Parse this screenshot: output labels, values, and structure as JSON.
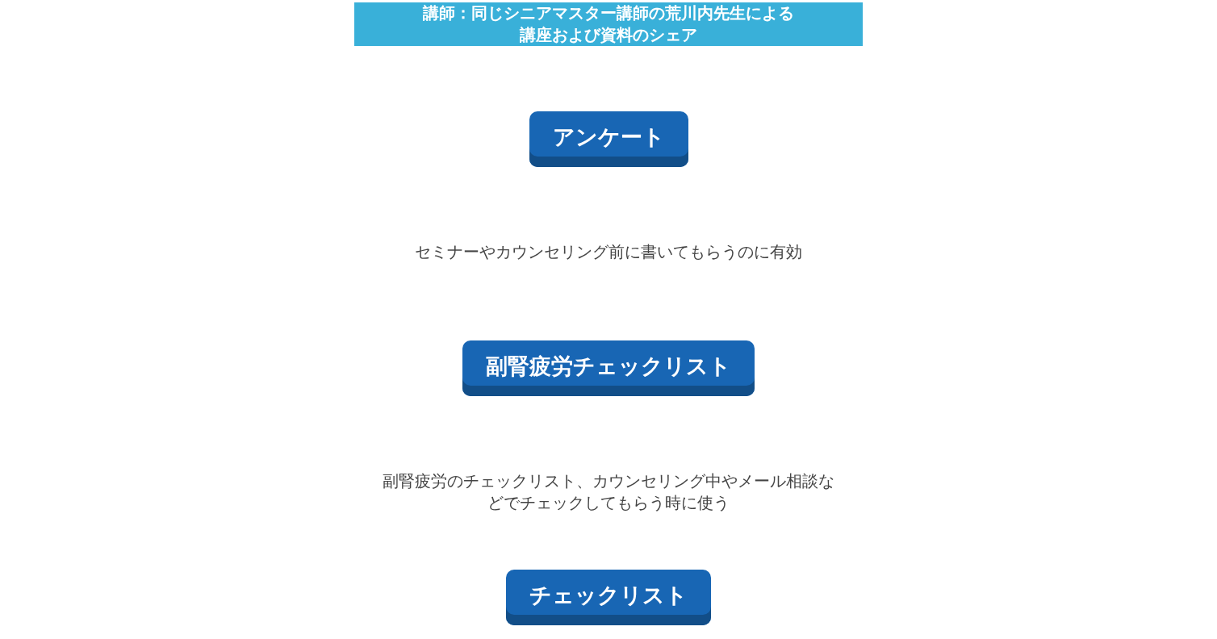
{
  "banner": {
    "title": "講師：同じシニアマスター講師の荒川内先生による講座および資料のシェア"
  },
  "sections": [
    {
      "button": "アンケート",
      "description": "セミナーやカウンセリング前に書いてもらうのに有効"
    },
    {
      "button": "副腎疲労チェックリスト",
      "description": "副腎疲労のチェックリスト、カウンセリング中やメール相談などでチェックしてもらう時に使う"
    },
    {
      "button": "チェックリスト"
    }
  ]
}
